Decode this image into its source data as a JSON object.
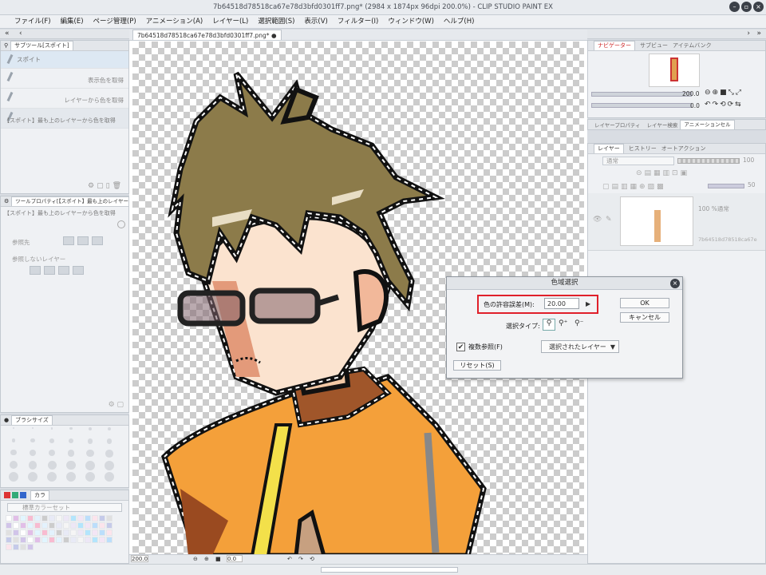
{
  "window": {
    "title": "7b64518d78518ca67e78d3bfd0301ff7.png* (2984 x 1874px 96dpi 200.0%)  - CLIP STUDIO PAINT EX",
    "controls": [
      "minimize",
      "maximize",
      "close"
    ]
  },
  "menu": [
    "ファイル(F)",
    "編集(E)",
    "ページ管理(P)",
    "アニメーション(A)",
    "レイヤー(L)",
    "選択範囲(S)",
    "表示(V)",
    "フィルター(I)",
    "ウィンドウ(W)",
    "ヘルプ(H)"
  ],
  "subtool_panel": {
    "tab": "サブツール[スポイト]",
    "selected": "スポイト",
    "items": [
      "表示色を取得",
      "レイヤーから色を取得",
      "【スポイト】最も上のレイヤーから色を取得"
    ]
  },
  "tool_property": {
    "tab": "ツールプロパティ[【スポイト】最も上のレイヤー",
    "subtitle": "【スポイト】最も上のレイヤーから色を取得",
    "ref_label": "参照先",
    "no_ref_label": "参照しないレイヤー"
  },
  "brush_size": {
    "tab": "ブラシサイズ",
    "sizes": [
      "0.7",
      "1",
      "1.5",
      "2",
      "2.5",
      "3",
      "4",
      "5",
      "6",
      "7",
      "8",
      "10",
      "12",
      "15",
      "17",
      "20",
      "25",
      "30",
      "40",
      "50",
      "60",
      "70",
      "80",
      "100",
      "120",
      "150",
      "170",
      "200",
      "250",
      "300"
    ]
  },
  "color_set": {
    "tab": "カラ",
    "label": "標準カラーセット"
  },
  "document": {
    "tab": "7b64518d78518ca67e78d3bfd0301ff7.png*",
    "zoom": "200.0",
    "angle": "0.0"
  },
  "navigator": {
    "tabs": [
      "ナビゲーター",
      "サブビュー",
      "アイテムバンク"
    ],
    "zoom": "200.0",
    "angle": "0.0"
  },
  "layer_property_tabs": [
    "レイヤープロパティ",
    "レイヤー検索",
    "アニメーションセル"
  ],
  "layer_panel": {
    "tabs": [
      "レイヤー",
      "ヒストリー",
      "オートアクション"
    ],
    "blend_mode": "通常",
    "opacity": "100",
    "sub_opacity": "50",
    "layer_info": "100 %通常",
    "layer_name": "7b64518d78518ca67e"
  },
  "dialog": {
    "title": "色域選択",
    "tolerance_label": "色の許容誤差(M):",
    "tolerance_value": "20.00",
    "select_type_label": "選択タイプ:",
    "multi_ref_label": "複数参照(F)",
    "multi_ref_checked": true,
    "ref_dropdown": "選択されたレイヤー",
    "reset": "リセット(S)",
    "ok": "OK",
    "cancel": "キャンセル",
    "highlight_color": "#e0202a"
  }
}
